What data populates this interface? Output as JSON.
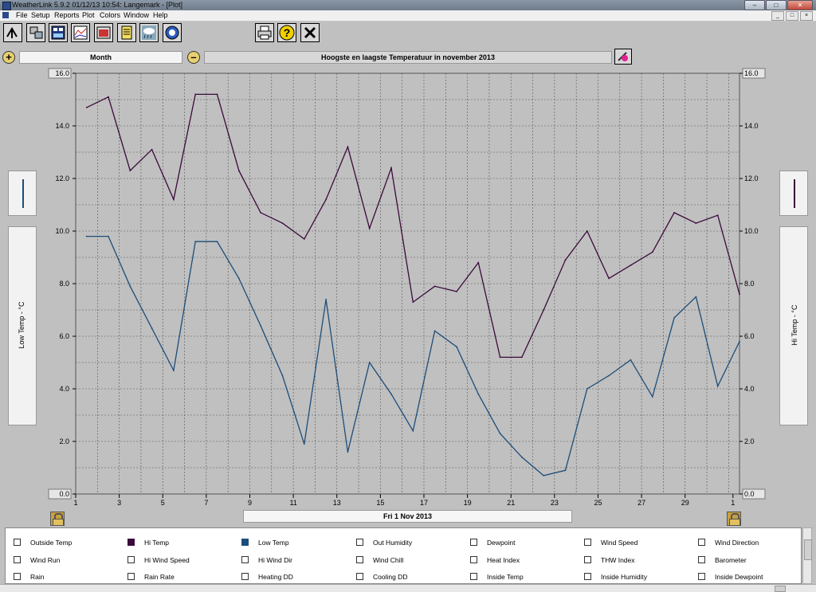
{
  "window": {
    "title": "WeatherLink 5.9.2  01/12/13  10:54: Langemark - [Plot]"
  },
  "menu": [
    "File",
    "Setup",
    "Reports",
    "Plot",
    "Colors",
    "Window",
    "Help"
  ],
  "toolbar": {
    "icons": [
      "station-select-icon",
      "download-icon",
      "bulletin-icon",
      "strip-charts-icon",
      "browse-icon",
      "notes-icon",
      "weather-icon",
      "noaa-icon",
      "print-icon",
      "help-icon",
      "close-icon"
    ]
  },
  "plot_controls": {
    "period": "Month",
    "title": "Hoogste en laagste Temperatuur in november 2013",
    "date": "Fri 1 Nov 2013"
  },
  "axes": {
    "left_label": "Low Temp - °C",
    "right_label": "Hi Temp - °C"
  },
  "colors": {
    "hi_temp": "#3a0a3a",
    "low_temp": "#1c4d7a",
    "grid": "#555555"
  },
  "chart_data": {
    "type": "line",
    "xlabel": "",
    "ylim": [
      0,
      16
    ],
    "grid": true,
    "x_tick_labels": [
      "1",
      "3",
      "5",
      "7",
      "9",
      "11",
      "13",
      "15",
      "17",
      "19",
      "21",
      "23",
      "25",
      "27",
      "29",
      "1"
    ],
    "y_tick_labels": [
      "16.0",
      "14.0",
      "12.0",
      "10.0",
      "8.0",
      "6.0",
      "4.0",
      "2.0",
      "0.0"
    ],
    "x": [
      1.5,
      2.5,
      3.5,
      4.5,
      5.5,
      6.5,
      7.5,
      8.5,
      9.5,
      10.5,
      11.5,
      12.5,
      13.5,
      14.5,
      15.5,
      16.5,
      17.5,
      18.5,
      19.5,
      20.5,
      21.5,
      22.5,
      23.5,
      24.5,
      25.5,
      26.5,
      27.5,
      28.5,
      29.5,
      30.5,
      31.5
    ],
    "series": [
      {
        "name": "Hi Temp",
        "axis": "right",
        "color": "#3a0a3a",
        "values": [
          14.7,
          15.1,
          12.3,
          13.1,
          11.2,
          15.2,
          15.2,
          12.3,
          10.7,
          10.3,
          9.7,
          11.2,
          13.2,
          10.1,
          12.4,
          7.3,
          7.9,
          7.7,
          8.8,
          5.2,
          5.2,
          7.0,
          8.9,
          10.0,
          8.2,
          8.7,
          9.2,
          10.7,
          10.3,
          10.6,
          7.6
        ]
      },
      {
        "name": "Low Temp",
        "axis": "left",
        "color": "#1c4d7a",
        "values": [
          9.8,
          9.8,
          7.9,
          6.3,
          4.7,
          9.6,
          9.6,
          8.2,
          6.4,
          4.5,
          1.9,
          7.4,
          1.6,
          5.0,
          3.8,
          2.4,
          6.2,
          5.6,
          3.8,
          2.3,
          1.4,
          0.7,
          0.9,
          4.0,
          4.5,
          5.1,
          3.7,
          6.7,
          7.5,
          4.1,
          5.8
        ]
      }
    ]
  },
  "legend": [
    [
      "Outside Temp",
      "Wind Run",
      "Rain"
    ],
    [
      "Hi Temp",
      "Hi Wind Speed",
      "Rain Rate"
    ],
    [
      "Low Temp",
      "Hi Wind Dir",
      "Heating DD"
    ],
    [
      "Out Humidity",
      "Wind Chill",
      "Cooling DD"
    ],
    [
      "Dewpoint",
      "Heat Index",
      "Inside Temp"
    ],
    [
      "Wind Speed",
      "THW Index",
      "Inside Humidity"
    ],
    [
      "Wind Direction",
      "Barometer",
      "Inside Dewpoint"
    ]
  ]
}
